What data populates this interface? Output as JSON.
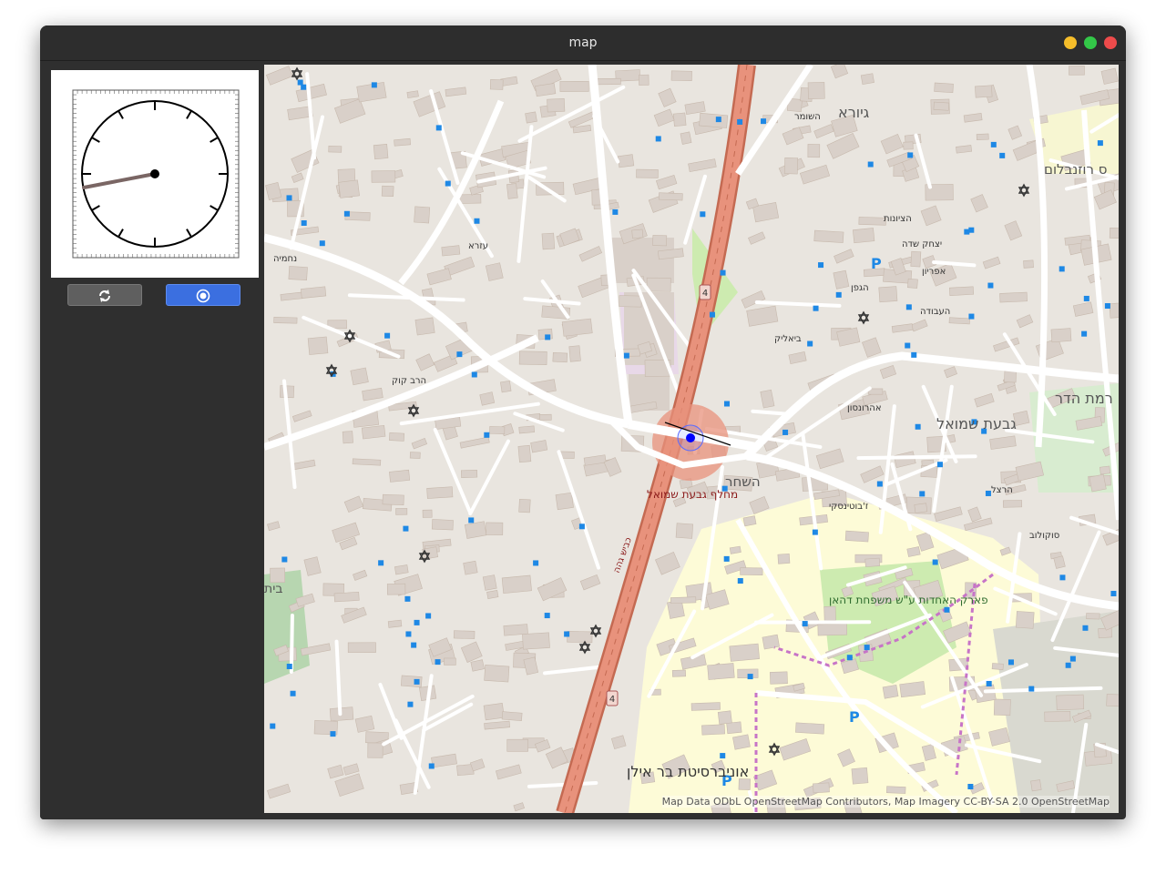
{
  "window": {
    "title": "map"
  },
  "sidebar": {
    "refresh_icon": "refresh-icon",
    "locate_icon": "target-icon"
  },
  "colors": {
    "accent": "#3b6fe0",
    "window_bg": "#2f2f2f",
    "highway": "#e8927c",
    "park": "#c8facc",
    "building": "#d9d0c9",
    "location_dot": "#0000ff"
  },
  "map": {
    "attribution": "Map Data ODbL OpenStreetMap Contributors, Map Imagery CC-BY-SA 2.0 OpenStreetMap",
    "labels": {
      "giora": "גיורא",
      "givat_shmuel": "גבעת שמואל",
      "ramat_hadar": "רמת הדר",
      "hashachar": "השחר",
      "interchange": "מחלף גבעת שמואל",
      "bar_ilan_univ": "אוניברסיטת בר אילן",
      "park": "פארק האחדות ע\"ש משפחת דהאן",
      "rosenblum": "ס רוזנבלום",
      "nachmiya": "נחמיה",
      "ezra": "עזרא",
      "bialik": "ביאליק",
      "beit": "בית",
      "road4": "4",
      "hashomer": "השומר",
      "kvish_geha": "כביש גהה",
      "zabotinsky": "ז'בוטינסקי",
      "rav_kook": "הרב קוק",
      "hatsionut": "הציונות",
      "hagefen": "הגפן",
      "aharonson": "אהרונסון",
      "sokolov": "סוקולוב",
      "herzl": "הרצל",
      "yitzhak_sade": "יצחק שדה",
      "apirion": "אפריון",
      "haavoda": "העבודה"
    }
  }
}
